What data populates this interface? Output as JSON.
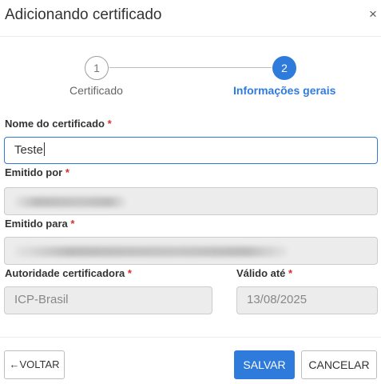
{
  "dialog": {
    "title": "Adicionando certificado",
    "close_glyph": "×"
  },
  "stepper": {
    "steps": [
      {
        "number": "1",
        "label": "Certificado",
        "state": "done"
      },
      {
        "number": "2",
        "label": "Informações gerais",
        "state": "active"
      }
    ]
  },
  "form": {
    "required_mark": "*",
    "nome": {
      "label": "Nome do certificado",
      "value": "Teste"
    },
    "emitido_por": {
      "label": "Emitido por",
      "value": ""
    },
    "emitido_para": {
      "label": "Emitido para",
      "value": ""
    },
    "autoridade": {
      "label": "Autoridade certificadora",
      "value": "ICP-Brasil"
    },
    "valido_ate": {
      "label": "Válido até",
      "value": "13/08/2025"
    }
  },
  "footer": {
    "back_label": "←VOLTAR",
    "save_label": "SALVAR",
    "cancel_label": "CANCELAR"
  },
  "colors": {
    "accent": "#2f7bdc",
    "required": "#d32f2f",
    "disabled_bg": "#ececec"
  },
  "icons": {
    "close": "close-icon",
    "back_arrow": "arrow-left-icon"
  }
}
